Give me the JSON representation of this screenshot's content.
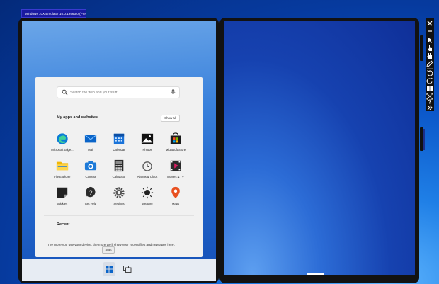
{
  "window": {
    "title": "Windows 10X Emulator 10.0.19563.0 (Preview)"
  },
  "search": {
    "placeholder": "Search the web and your stuff"
  },
  "apps_section": {
    "title": "My apps and websites",
    "show_all_label": "Show all",
    "apps": [
      {
        "label": "Microsoft Edge...",
        "icon": "edge-icon"
      },
      {
        "label": "Mail",
        "icon": "mail-icon"
      },
      {
        "label": "Calendar",
        "icon": "calendar-icon"
      },
      {
        "label": "Photos",
        "icon": "photos-icon"
      },
      {
        "label": "Microsoft Store",
        "icon": "store-icon"
      },
      {
        "label": "File Explorer",
        "icon": "folder-icon"
      },
      {
        "label": "Camera",
        "icon": "camera-icon"
      },
      {
        "label": "Calculator",
        "icon": "calculator-icon"
      },
      {
        "label": "Alarms & Clock",
        "icon": "alarm-clock-icon"
      },
      {
        "label": "Movies & TV",
        "icon": "movies-icon"
      },
      {
        "label": "Stickies",
        "icon": "sticky-note-icon"
      },
      {
        "label": "Get Help",
        "icon": "help-icon"
      },
      {
        "label": "Settings",
        "icon": "settings-icon"
      },
      {
        "label": "Weather",
        "icon": "weather-icon"
      },
      {
        "label": "Maps",
        "icon": "maps-icon"
      }
    ]
  },
  "recent": {
    "title": "Recent",
    "empty_message": "The more you use your device, the more we'll show your recent files and new apps here."
  },
  "taskbar": {
    "start_tooltip": "Start"
  },
  "toolbar": {
    "items": [
      "close-icon",
      "minimize-icon",
      "select-icon",
      "touch-icon",
      "multi-touch-icon",
      "pen-icon",
      "rotate-left-icon",
      "rotate-right-icon",
      "book-mode-icon",
      "fit-screen-icon",
      "help-icon",
      "more-icon"
    ]
  },
  "colors": {
    "accent": "#0a55c8",
    "device_frame": "#121212",
    "panel": "#f1f1f1"
  }
}
